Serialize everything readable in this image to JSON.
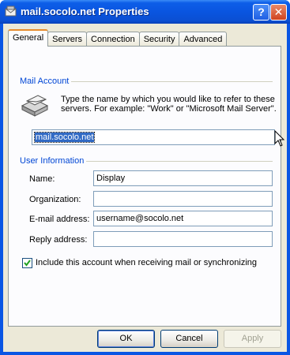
{
  "window": {
    "title": "mail.socolo.net Properties",
    "help_glyph": "?",
    "close_glyph": "✕"
  },
  "tabs": [
    {
      "label": "General",
      "active": true
    },
    {
      "label": "Servers",
      "active": false
    },
    {
      "label": "Connection",
      "active": false
    },
    {
      "label": "Security",
      "active": false
    },
    {
      "label": "Advanced",
      "active": false
    }
  ],
  "mail_account": {
    "group_label": "Mail Account",
    "description": "Type the name by which you would like to refer to these servers.  For example: \"Work\" or \"Microsoft Mail Server\".",
    "account_name": "mail.socolo.net"
  },
  "user_information": {
    "group_label": "User Information",
    "name_label": "Name:",
    "name_value": "Display",
    "organization_label": "Organization:",
    "organization_value": "",
    "email_label": "E-mail address:",
    "email_value": "username@socolo.net",
    "reply_label": "Reply address:",
    "reply_value": ""
  },
  "include_account": {
    "label": "Include this account when receiving mail or synchronizing",
    "checked": true
  },
  "buttons": {
    "ok": "OK",
    "cancel": "Cancel",
    "apply": "Apply"
  },
  "icons": [
    "mail-account-icon",
    "help-icon",
    "close-icon",
    "mouse-pointer-icon",
    "checkmark-icon"
  ]
}
